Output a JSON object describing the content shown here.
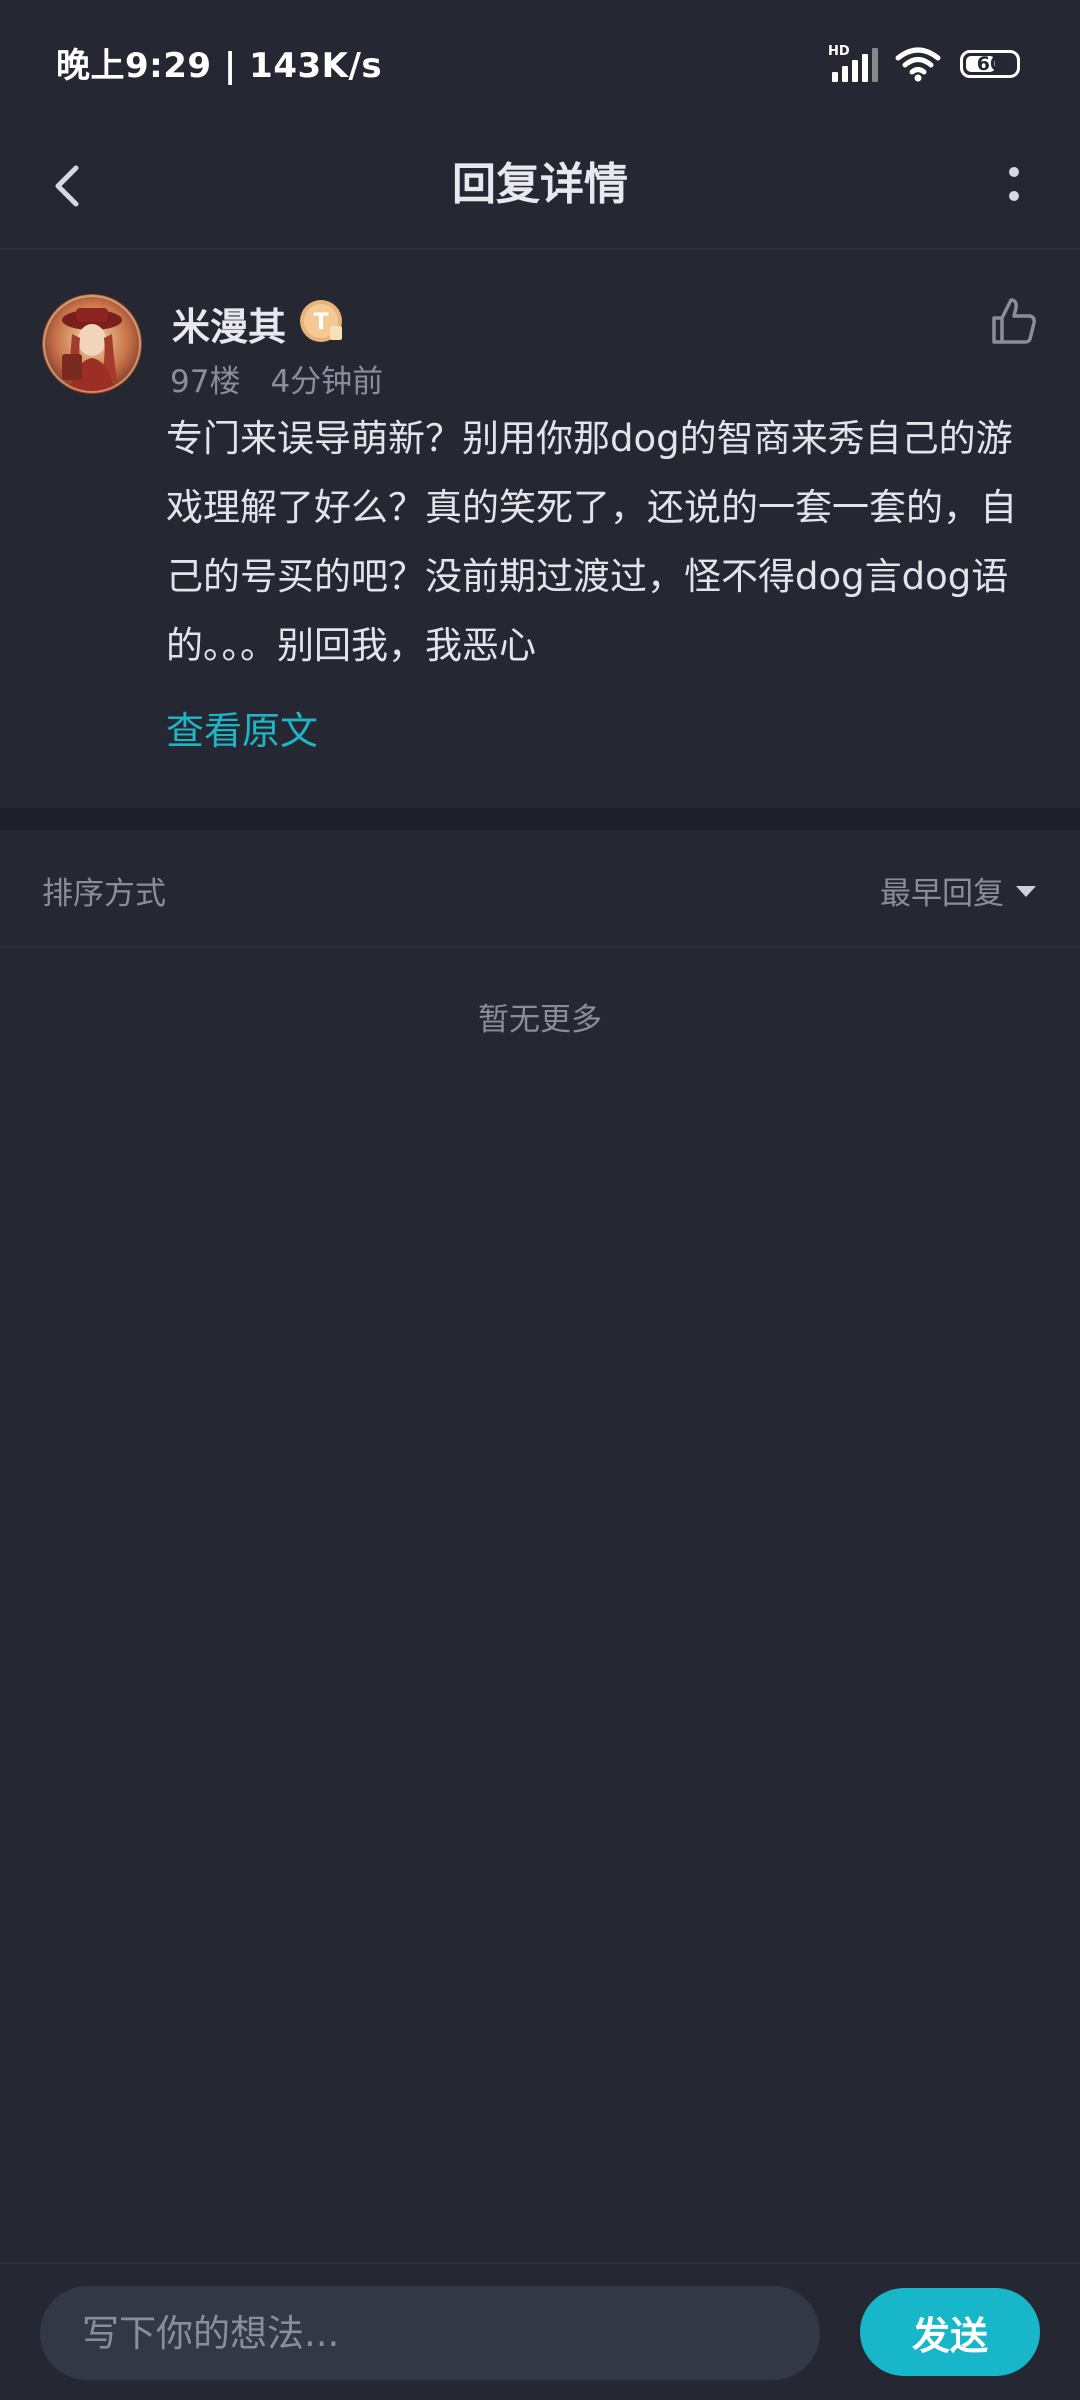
{
  "status_bar": {
    "time_speed": "晚上9:29 | 143K/s",
    "signal_label": "HD",
    "battery_level": "60",
    "battery_fraction": 0.6
  },
  "header": {
    "title": "回复详情",
    "back_icon": "chevron-left-icon",
    "more_icon": "more-vertical-icon"
  },
  "comment": {
    "username": "米漫其",
    "floor": "97楼",
    "time": "4分钟前",
    "text": "专门来误导萌新？别用你那dog的智商来秀自己的游戏理解了好么？真的笑死了，还说的一套一套的，自己的号买的吧？没前期过渡过，怪不得dog言dog语的。。。别回我，我恶心",
    "view_original": "查看原文",
    "like_icon": "thumbs-up-icon",
    "badge_icon": "level-badge-icon"
  },
  "sort": {
    "label": "排序方式",
    "selected": "最早回复",
    "arrow_icon": "caret-down-icon"
  },
  "empty_note": "暂无更多",
  "composer": {
    "placeholder": "写下你的想法...",
    "send_label": "发送"
  },
  "colors": {
    "background": "#252733",
    "accent": "#17b7c9",
    "link": "#1fb5c4",
    "muted_text": "#8b8e9a"
  }
}
